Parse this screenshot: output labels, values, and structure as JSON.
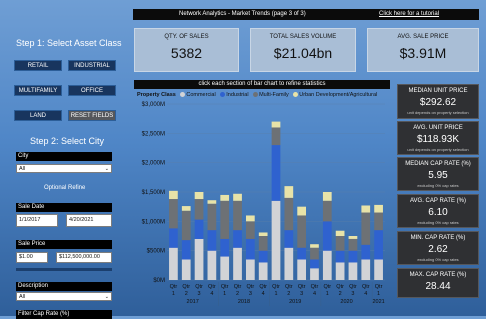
{
  "header": {
    "title": "Network Analytics - Market Trends (page 3 of 3)",
    "tutorial": "Click here for a tutorial"
  },
  "step1": {
    "title": "Step 1: Select Asset Class",
    "buttons": [
      "RETAIL",
      "INDUSTRIAL",
      "MULTIFAMILY",
      "OFFICE",
      "LAND",
      "RESET FIELDS"
    ]
  },
  "step2": {
    "title": "Step 2: Select City",
    "city_label": "City",
    "city_value": "All",
    "optional": "Optional Refine",
    "sale_date_label": "Sale Date",
    "date_from": "1/1/2017",
    "date_to": "4/20/2021",
    "sale_price_label": "Sale Price",
    "price_from": "$1.00",
    "price_to": "$112,500,000.00",
    "description_label": "Description",
    "description_value": "All",
    "filter_label": "Filter Cap Rate (%)"
  },
  "kpis": [
    {
      "label": "QTY. OF SALES",
      "value": "5382"
    },
    {
      "label": "TOTAL SALES VOLUME",
      "value": "$21.04bn"
    },
    {
      "label": "AVG. SALE PRICE",
      "value": "$3.91M"
    }
  ],
  "right_kpis": [
    {
      "label": "MEDIAN UNIT PRICE",
      "value": "$292.62",
      "note": "unit depends on property selection"
    },
    {
      "label": "AVG. UNIT PRICE",
      "value": "$118.93K",
      "note": "unit depends on property selection"
    },
    {
      "label": "MEDIAN CAP RATE (%)",
      "value": "5.95",
      "note": "excluding 0% cap rates"
    },
    {
      "label": "AVG. CAP RATE (%)",
      "value": "6.10",
      "note": "excluding 0% cap rates"
    },
    {
      "label": "MIN. CAP RATE (%)",
      "value": "2.62",
      "note": "excluding 0% cap rates"
    },
    {
      "label": "MAX. CAP RATE (%)",
      "value": "28.44",
      "note": ""
    }
  ],
  "chart_banner": "click each section of bar chart to refine statistics",
  "colors": {
    "commercial": "#d2d3d6",
    "industrial": "#2f62cf",
    "multifamily": "#6d7175",
    "urban": "#e8e3a8"
  },
  "chart_data": {
    "type": "bar",
    "legend_title": "Property Class",
    "legend_position": "top-left",
    "yticks": [
      "$3,000M",
      "$2,500M",
      "$2,000M",
      "$1,500M",
      "$1,000M",
      "$500M",
      "$0M"
    ],
    "ylim": [
      0,
      3000
    ],
    "categories": [
      "Qtr 1",
      "Qtr 2",
      "Qtr 3",
      "Qtr 4",
      "Qtr 1",
      "Qtr 2",
      "Qtr 3",
      "Qtr 4",
      "Qtr 1",
      "Qtr 2",
      "Qtr 3",
      "Qtr 4",
      "Qtr 1",
      "Qtr 2",
      "Qtr 3",
      "Qtr 4",
      "Qtr 1"
    ],
    "years": [
      "2017",
      "2018",
      "2019",
      "2020",
      "2021"
    ],
    "year_spans": [
      4,
      4,
      4,
      4,
      1
    ],
    "series": [
      {
        "name": "Commercial",
        "values": [
          550,
          350,
          700,
          500,
          400,
          550,
          350,
          300,
          1350,
          550,
          350,
          200,
          500,
          300,
          300,
          350,
          350
        ]
      },
      {
        "name": "Industrial",
        "values": [
          330,
          330,
          330,
          350,
          300,
          300,
          350,
          200,
          950,
          300,
          200,
          150,
          500,
          200,
          200,
          250,
          500
        ]
      },
      {
        "name": "Multi-Family",
        "values": [
          500,
          500,
          350,
          450,
          650,
          500,
          300,
          250,
          300,
          550,
          550,
          200,
          350,
          250,
          200,
          550,
          300
        ]
      },
      {
        "name": "Urban Development/Agricultural",
        "values": [
          140,
          80,
          120,
          60,
          100,
          120,
          100,
          60,
          100,
          200,
          150,
          60,
          150,
          90,
          50,
          120,
          130
        ]
      }
    ]
  }
}
